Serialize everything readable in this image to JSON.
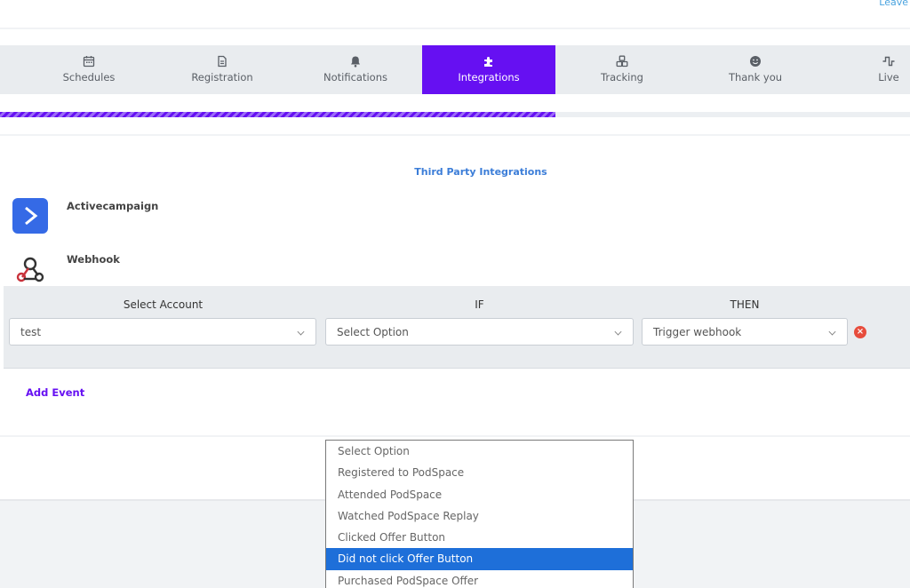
{
  "header": {
    "leave_label": "Leave"
  },
  "steps": [
    {
      "label": "Schedules",
      "icon": "calendar-icon"
    },
    {
      "label": "Registration",
      "icon": "document-icon"
    },
    {
      "label": "Notifications",
      "icon": "bell-icon"
    },
    {
      "label": "Integrations",
      "icon": "puzzle-icon",
      "active": true
    },
    {
      "label": "Tracking",
      "icon": "cubes-icon"
    },
    {
      "label": "Thank you",
      "icon": "smile-icon"
    },
    {
      "label": "Live",
      "icon": "pulse-icon"
    }
  ],
  "progress": {
    "percent": 61,
    "color": "#6610f2"
  },
  "integrations": {
    "title": "Third Party Integrations",
    "items": [
      {
        "name": "Activecampaign",
        "icon": "activecampaign-icon",
        "color": "#356ae6"
      },
      {
        "name": "Webhook",
        "icon": "webhook-icon"
      }
    ]
  },
  "event_row": {
    "headers": {
      "account": "Select Account",
      "if": "IF",
      "then": "THEN"
    },
    "account_value": "test",
    "if_value": "Select Option",
    "then_value": "Trigger webhook"
  },
  "add_event_label": "Add Event",
  "dropdown": {
    "options": [
      "Select Option",
      "Registered to PodSpace",
      "Attended PodSpace",
      "Watched PodSpace Replay",
      "Clicked Offer Button",
      "Did not click Offer Button",
      "Purchased PodSpace Offer"
    ],
    "highlighted": "Did not click Offer Button"
  },
  "colors": {
    "accent": "#6610f2",
    "link": "#3b7dd8",
    "danger": "#e74c3c",
    "highlight": "#1e6fd9"
  }
}
